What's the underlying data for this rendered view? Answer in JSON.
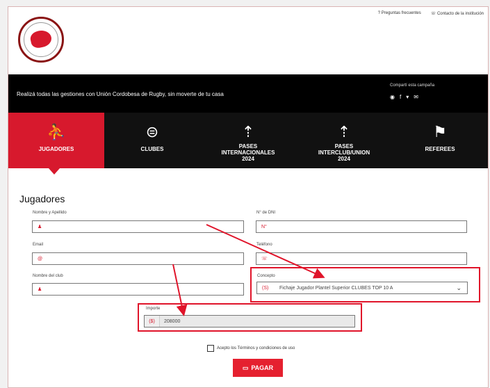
{
  "toplinks": {
    "faq": "Preguntas frecuentes",
    "contact": "Contacto de la institución"
  },
  "banner": {
    "tagline": "Realizá todas las gestiones con Unión Cordobesa de Rugby, sin moverte de tu casa",
    "share_label": "Compartí esta campaña"
  },
  "nav": [
    {
      "label": "JUGADORES",
      "icon": "players-icon",
      "active": true
    },
    {
      "label": "CLUBES",
      "icon": "stadium-icon",
      "active": false
    },
    {
      "label": "PASES INTERNACIONALES 2024",
      "icon": "transfer-international-icon",
      "active": false
    },
    {
      "label": "PASES INTERCLUB/UNION 2024",
      "icon": "transfer-interclub-icon",
      "active": false
    },
    {
      "label": "REFEREES",
      "icon": "flag-icon",
      "active": false
    }
  ],
  "form": {
    "title": "Jugadores",
    "name_label": "Nombre y Apellido",
    "dni_label": "N° de DNI",
    "dni_prefix": "N°",
    "email_label": "Email",
    "email_prefix": "@",
    "phone_label": "Teléfono",
    "club_label": "Nombre del club",
    "concept_label": "Concepto",
    "concept_prefix": "(S)",
    "concept_value": "Fichaje Jugador Plantel Superior CLUBES TOP 10 A",
    "amount_label": "Importe",
    "amount_prefix": "($)",
    "amount_value": "208000",
    "terms": "Acepto los Términos y condiciones de uso",
    "pay_button": "PAGAR"
  },
  "colors": {
    "accent": "#d7192d",
    "highlight": "#e0142a",
    "banner": "#000000"
  }
}
